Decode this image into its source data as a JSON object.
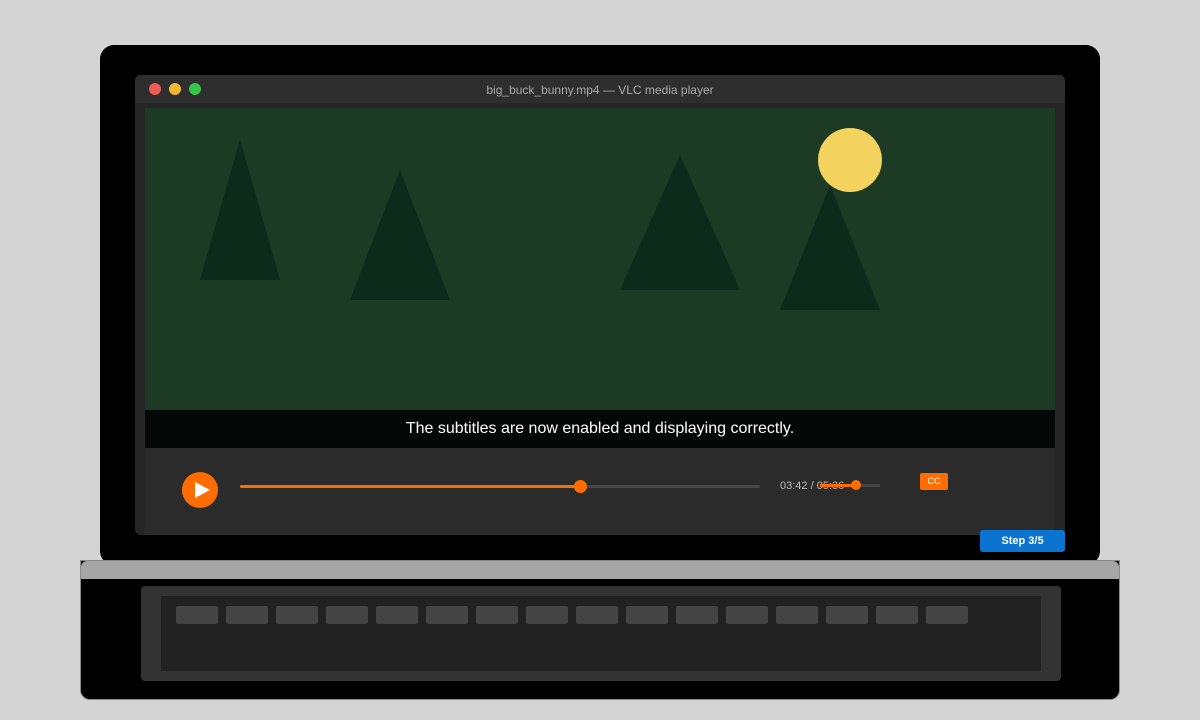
{
  "window": {
    "title": "big_buck_bunny.mp4 — VLC media player"
  },
  "video": {
    "subtitle": "The subtitles are now enabled and displaying correctly."
  },
  "controls": {
    "progress_fraction": 0.654,
    "time_display": "03:42 / 05:36",
    "volume_fraction": 0.6,
    "cc_label": "CC"
  },
  "overlay": {
    "step_label": "Step 3/5"
  },
  "colors": {
    "accent": "#ff6d00",
    "video_bg": "#1c3a24",
    "badge": "#0b74d1"
  }
}
